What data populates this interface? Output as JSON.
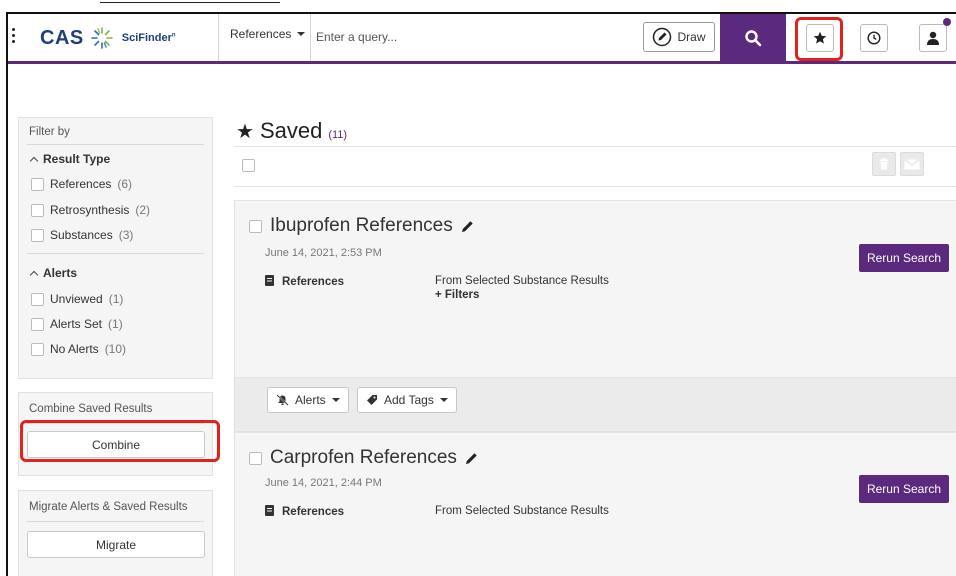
{
  "header": {
    "brand": "CAS",
    "product": "SciFinder",
    "product_mark": "n",
    "search_type": "References",
    "query_placeholder": "Enter a query...",
    "draw_label": "Draw"
  },
  "sidebar": {
    "filter_title": "Filter by",
    "sections": [
      {
        "title": "Result Type",
        "items": [
          {
            "label": "References",
            "count": "(6)"
          },
          {
            "label": "Retrosynthesis",
            "count": "(2)"
          },
          {
            "label": "Substances",
            "count": "(3)"
          }
        ]
      },
      {
        "title": "Alerts",
        "items": [
          {
            "label": "Unviewed",
            "count": "(1)"
          },
          {
            "label": "Alerts Set",
            "count": "(1)"
          },
          {
            "label": "No Alerts",
            "count": "(10)"
          }
        ]
      }
    ],
    "combine_title": "Combine Saved Results",
    "combine_button": "Combine",
    "migrate_title": "Migrate Alerts & Saved Results",
    "migrate_button": "Migrate"
  },
  "main": {
    "title": "Saved",
    "count": "(11)",
    "results": [
      {
        "name": "Ibuprofen References",
        "date": "June 14, 2021, 2:53 PM",
        "type": "References",
        "source": "From Selected Substance Results",
        "extra": "+ Filters",
        "rerun": "Rerun Search"
      },
      {
        "name": "Carprofen References",
        "date": "June 14, 2021, 2:44 PM",
        "type": "References",
        "source": "From Selected Substance Results",
        "rerun": "Rerun Search"
      }
    ],
    "footer": {
      "alerts_label": "Alerts",
      "tags_label": "Add Tags"
    }
  },
  "colors": {
    "brand_purple": "#5b2a7e",
    "highlight_red": "#e0231c",
    "cas_blue": "#1f3f7a"
  }
}
